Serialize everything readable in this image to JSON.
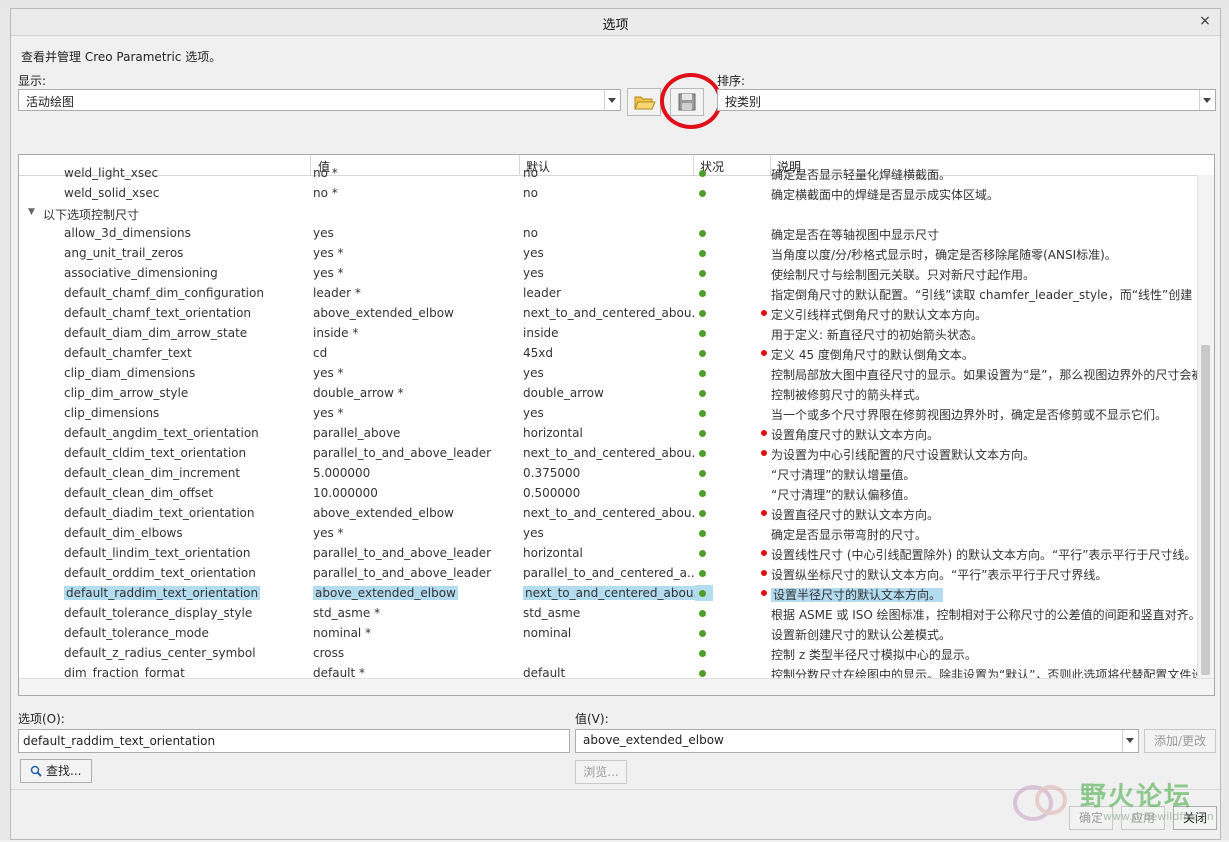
{
  "dialog": {
    "title": "选项",
    "close": "×",
    "description": "查看并管理 Creo Parametric 选项。"
  },
  "show": {
    "label": "显示:",
    "value": "活动绘图"
  },
  "sort": {
    "label": "排序:",
    "value": "按类别"
  },
  "table": {
    "headers": {
      "value": "值",
      "default": "默认",
      "status": "状况",
      "description": "说明"
    },
    "group_label": "以下选项控制尺寸",
    "rows_before": [
      {
        "name": "weld_light_xsec",
        "value": "no *",
        "default": "no",
        "red": false,
        "desc": "确定是否显示轻量化焊缝横截面。"
      },
      {
        "name": "weld_solid_xsec",
        "value": "no *",
        "default": "no",
        "red": false,
        "desc": "确定横截面中的焊缝是否显示成实体区域。"
      }
    ],
    "rows": [
      {
        "name": "allow_3d_dimensions",
        "value": "yes",
        "default": "no",
        "red": false,
        "selected": false,
        "desc": "确定是否在等轴视图中显示尺寸"
      },
      {
        "name": "ang_unit_trail_zeros",
        "value": "yes *",
        "default": "yes",
        "red": false,
        "selected": false,
        "desc": "当角度以度/分/秒格式显示时，确定是否移除尾随零(ANSI标准)。"
      },
      {
        "name": "associative_dimensioning",
        "value": "yes *",
        "default": "yes",
        "red": false,
        "selected": false,
        "desc": "使绘制尺寸与绘制图元关联。只对新尺寸起作用。"
      },
      {
        "name": "default_chamf_dim_configuration",
        "value": "leader *",
        "default": "leader",
        "red": false,
        "selected": false,
        "desc": "指定倒角尺寸的默认配置。“引线”读取 chamfer_leader_style，而“线性”创建"
      },
      {
        "name": "default_chamf_text_orientation",
        "value": "above_extended_elbow",
        "default": "next_to_and_centered_abou...",
        "red": true,
        "selected": false,
        "desc": "定义引线样式倒角尺寸的默认文本方向。"
      },
      {
        "name": "default_diam_dim_arrow_state",
        "value": "inside *",
        "default": "inside",
        "red": false,
        "selected": false,
        "desc": "用于定义: 新直径尺寸的初始箭头状态。"
      },
      {
        "name": "default_chamfer_text",
        "value": "cd",
        "default": "45xd",
        "red": true,
        "selected": false,
        "desc": "定义 45 度倒角尺寸的默认倒角文本。"
      },
      {
        "name": "clip_diam_dimensions",
        "value": "yes *",
        "default": "yes",
        "red": false,
        "selected": false,
        "desc": "控制局部放大图中直径尺寸的显示。如果设置为“是”，那么视图边界外的尺寸会被"
      },
      {
        "name": "clip_dim_arrow_style",
        "value": "double_arrow *",
        "default": "double_arrow",
        "red": false,
        "selected": false,
        "desc": "控制被修剪尺寸的箭头样式。"
      },
      {
        "name": "clip_dimensions",
        "value": "yes *",
        "default": "yes",
        "red": false,
        "selected": false,
        "desc": "当一个或多个尺寸界限在修剪视图边界外时，确定是否修剪或不显示它们。"
      },
      {
        "name": "default_angdim_text_orientation",
        "value": "parallel_above",
        "default": "horizontal",
        "red": true,
        "selected": false,
        "desc": "设置角度尺寸的默认文本方向。"
      },
      {
        "name": "default_cldim_text_orientation",
        "value": "parallel_to_and_above_leader",
        "default": "next_to_and_centered_abou...",
        "red": true,
        "selected": false,
        "desc": "为设置为中心引线配置的尺寸设置默认文本方向。"
      },
      {
        "name": "default_clean_dim_increment",
        "value": "5.000000",
        "default": "0.375000",
        "red": false,
        "selected": false,
        "desc": "“尺寸清理”的默认增量值。"
      },
      {
        "name": "default_clean_dim_offset",
        "value": "10.000000",
        "default": "0.500000",
        "red": false,
        "selected": false,
        "desc": "“尺寸清理”的默认偏移值。"
      },
      {
        "name": "default_diadim_text_orientation",
        "value": "above_extended_elbow",
        "default": "next_to_and_centered_abou...",
        "red": true,
        "selected": false,
        "desc": "设置直径尺寸的默认文本方向。"
      },
      {
        "name": "default_dim_elbows",
        "value": "yes *",
        "default": "yes",
        "red": false,
        "selected": false,
        "desc": "确定是否显示带弯肘的尺寸。"
      },
      {
        "name": "default_lindim_text_orientation",
        "value": "parallel_to_and_above_leader",
        "default": "horizontal",
        "red": true,
        "selected": false,
        "desc": "设置线性尺寸 (中心引线配置除外) 的默认文本方向。“平行”表示平行于尺寸线。"
      },
      {
        "name": "default_orddim_text_orientation",
        "value": "parallel_to_and_above_leader",
        "default": "parallel_to_and_centered_a...",
        "red": true,
        "selected": false,
        "desc": "设置纵坐标尺寸的默认文本方向。“平行”表示平行于尺寸界线。"
      },
      {
        "name": "default_raddim_text_orientation",
        "value": "above_extended_elbow",
        "default": "next_to_and_centered_abou...",
        "red": true,
        "selected": true,
        "desc": "设置半径尺寸的默认文本方向。"
      },
      {
        "name": "default_tolerance_display_style",
        "value": "std_asme *",
        "default": "std_asme",
        "red": false,
        "selected": false,
        "desc": "根据 ASME 或 ISO 绘图标准，控制相对于公称尺寸的公差值的间距和竖直对齐。"
      },
      {
        "name": "default_tolerance_mode",
        "value": "nominal *",
        "default": "nominal",
        "red": false,
        "selected": false,
        "desc": "设置新创建尺寸的默认公差模式。"
      },
      {
        "name": "default_z_radius_center_symbol",
        "value": "cross",
        "default": "",
        "red": false,
        "selected": false,
        "desc": "控制 z 类型半径尺寸模拟中心的显示。"
      },
      {
        "name": "dim_fraction_format",
        "value": "default *",
        "default": "default",
        "red": false,
        "selected": false,
        "desc": "控制分数尺寸在绘图中的显示。除非设置为“默认”，否则此选项将代替配置文件设"
      }
    ]
  },
  "option": {
    "label": "选项(O):",
    "value": "default_raddim_text_orientation"
  },
  "valuefield": {
    "label": "值(V):",
    "value": "above_extended_elbow"
  },
  "buttons": {
    "add_change": "添加/更改",
    "find": "查找...",
    "browse": "浏览...",
    "ok": "确定",
    "apply": "应用",
    "close": "关闭"
  },
  "watermark": {
    "text": "野火论坛",
    "url": "www.proewildfire.cn"
  },
  "colors": {
    "accent_select": "#b3dcf0",
    "status_green": "#4e9e2a",
    "annotation_red": "#e0101a"
  }
}
